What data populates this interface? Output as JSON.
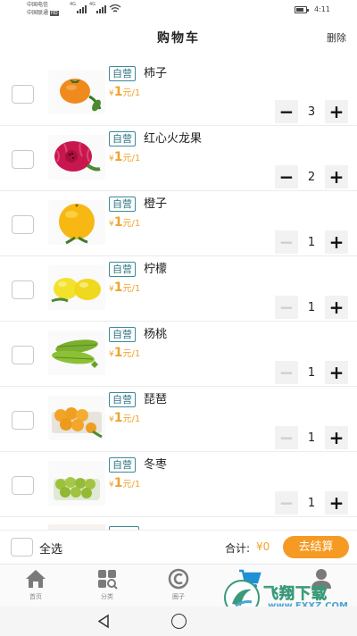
{
  "status_bar": {
    "carrier_1": "中国电信",
    "carrier_2": "中国联通",
    "hd_label": "HD",
    "net_1": "4G",
    "net_2": "4G",
    "time": "4:11"
  },
  "header": {
    "title": "购物车",
    "delete_label": "删除"
  },
  "cart": {
    "items": [
      {
        "badge": "自营",
        "name": "柿子",
        "price_symbol": "¥",
        "price": "1",
        "unit": "元/1",
        "quantity": "3",
        "minus": "−",
        "plus": "+",
        "minus_enabled": true,
        "image": "persimmon-image"
      },
      {
        "badge": "自营",
        "name": "红心火龙果",
        "price_symbol": "¥",
        "price": "1",
        "unit": "元/1",
        "quantity": "2",
        "minus": "−",
        "plus": "+",
        "minus_enabled": true,
        "image": "dragonfruit-image"
      },
      {
        "badge": "自营",
        "name": "橙子",
        "price_symbol": "¥",
        "price": "1",
        "unit": "元/1",
        "quantity": "1",
        "minus": "−",
        "plus": "+",
        "minus_enabled": false,
        "image": "orange-image"
      },
      {
        "badge": "自营",
        "name": "柠檬",
        "price_symbol": "¥",
        "price": "1",
        "unit": "元/1",
        "quantity": "1",
        "minus": "−",
        "plus": "+",
        "minus_enabled": false,
        "image": "lemon-image"
      },
      {
        "badge": "自营",
        "name": "杨桃",
        "price_symbol": "¥",
        "price": "1",
        "unit": "元/1",
        "quantity": "1",
        "minus": "−",
        "plus": "+",
        "minus_enabled": false,
        "image": "starfruit-image"
      },
      {
        "badge": "自营",
        "name": "琵琶",
        "price_symbol": "¥",
        "price": "1",
        "unit": "元/1",
        "quantity": "1",
        "minus": "−",
        "plus": "+",
        "minus_enabled": false,
        "image": "loquat-image"
      },
      {
        "badge": "自营",
        "name": "冬枣",
        "price_symbol": "¥",
        "price": "1",
        "unit": "元/1",
        "quantity": "1",
        "minus": "−",
        "plus": "+",
        "minus_enabled": false,
        "image": "jujube-image"
      }
    ]
  },
  "summary": {
    "select_all": "全选",
    "total_label": "合计:",
    "total_value": "¥0",
    "checkout": "去结算"
  },
  "tabbar": {
    "tabs": [
      {
        "label": "首页",
        "icon": "home-icon",
        "active": false
      },
      {
        "label": "分类",
        "icon": "category-icon",
        "active": false
      },
      {
        "label": "圈子",
        "icon": "circle-icon",
        "active": false
      },
      {
        "label": "购物车",
        "icon": "cart-icon",
        "active": true
      },
      {
        "label": "我的",
        "icon": "user-icon",
        "active": false
      }
    ]
  },
  "watermark": {
    "text": "飞翔下载",
    "url": "www.FXXZ.COM"
  },
  "colors": {
    "accent": "#f59a23",
    "price": "#f0a32e",
    "badge": "#2c7482",
    "cart_active": "#1e90d6"
  }
}
